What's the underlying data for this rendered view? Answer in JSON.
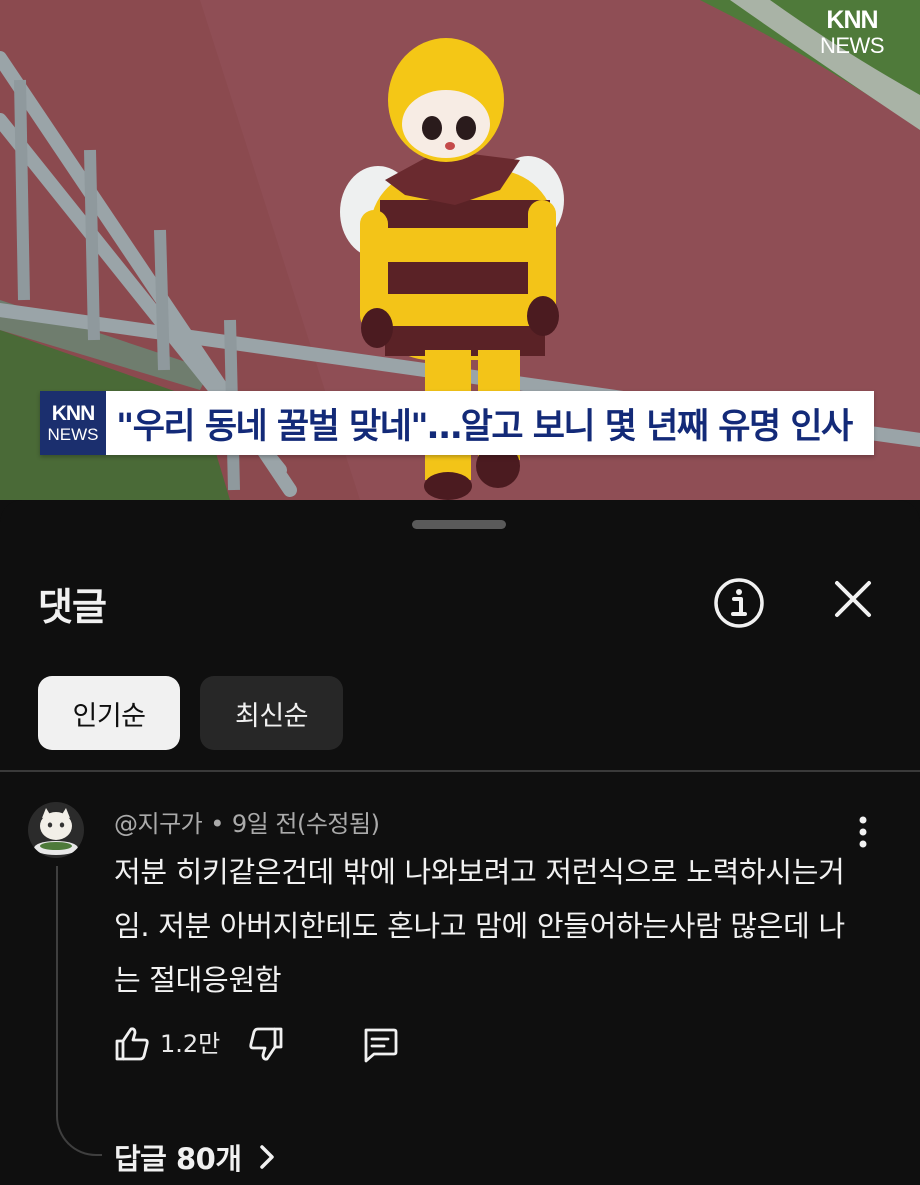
{
  "video": {
    "watermark": {
      "logo": "KNN",
      "sub": "NEWS"
    },
    "caption": {
      "logo_top": "KNN",
      "logo_bottom": "NEWS",
      "text": "\"우리 동네 꿀벌 맞네\"…알고 보니 몇 년째 유명 인사"
    }
  },
  "comments_panel": {
    "title": "댓글",
    "info_icon": "info-circle-icon",
    "close_icon": "close-icon",
    "sort_tabs": [
      {
        "label": "인기순",
        "active": true
      },
      {
        "label": "최신순",
        "active": false
      }
    ],
    "comment": {
      "author": "@지구가",
      "separator": "•",
      "time": "9일 전(수정됨)",
      "text": "저분 히키같은건데 밖에 나와보려고 저런식으로 노력하시는거임. 저분 아버지한테도 혼나고 맘에 안들어하는사람 많은데 나는 절대응원함",
      "like_count": "1.2만",
      "replies_label": "답글 80개"
    }
  },
  "colors": {
    "background": "#0f0f0f",
    "text": "#f1f1f1",
    "secondary_text": "#aaaaaa",
    "chip_active": "#f1f1f1",
    "chip_inactive": "#272727",
    "caption_blue": "#132a78"
  }
}
